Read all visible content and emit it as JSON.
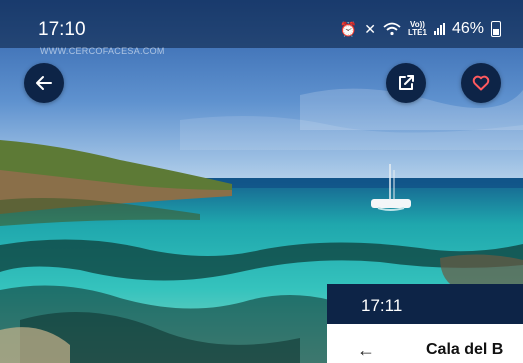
{
  "status_bar": {
    "time": "17:10",
    "signal_label": "Vo))\nLTE1",
    "battery": "46%"
  },
  "watermark": "WWW.CERCOFACESA.COM",
  "actions": {
    "back_icon": "arrow-left-icon",
    "share_icon": "share-icon",
    "favorite_icon": "heart-icon"
  },
  "overlay_screen": {
    "time": "17:11",
    "title": "Cala del B"
  },
  "colors": {
    "nav_button_bg": "#0d2447",
    "favorite_accent": "#ff5a5f"
  }
}
